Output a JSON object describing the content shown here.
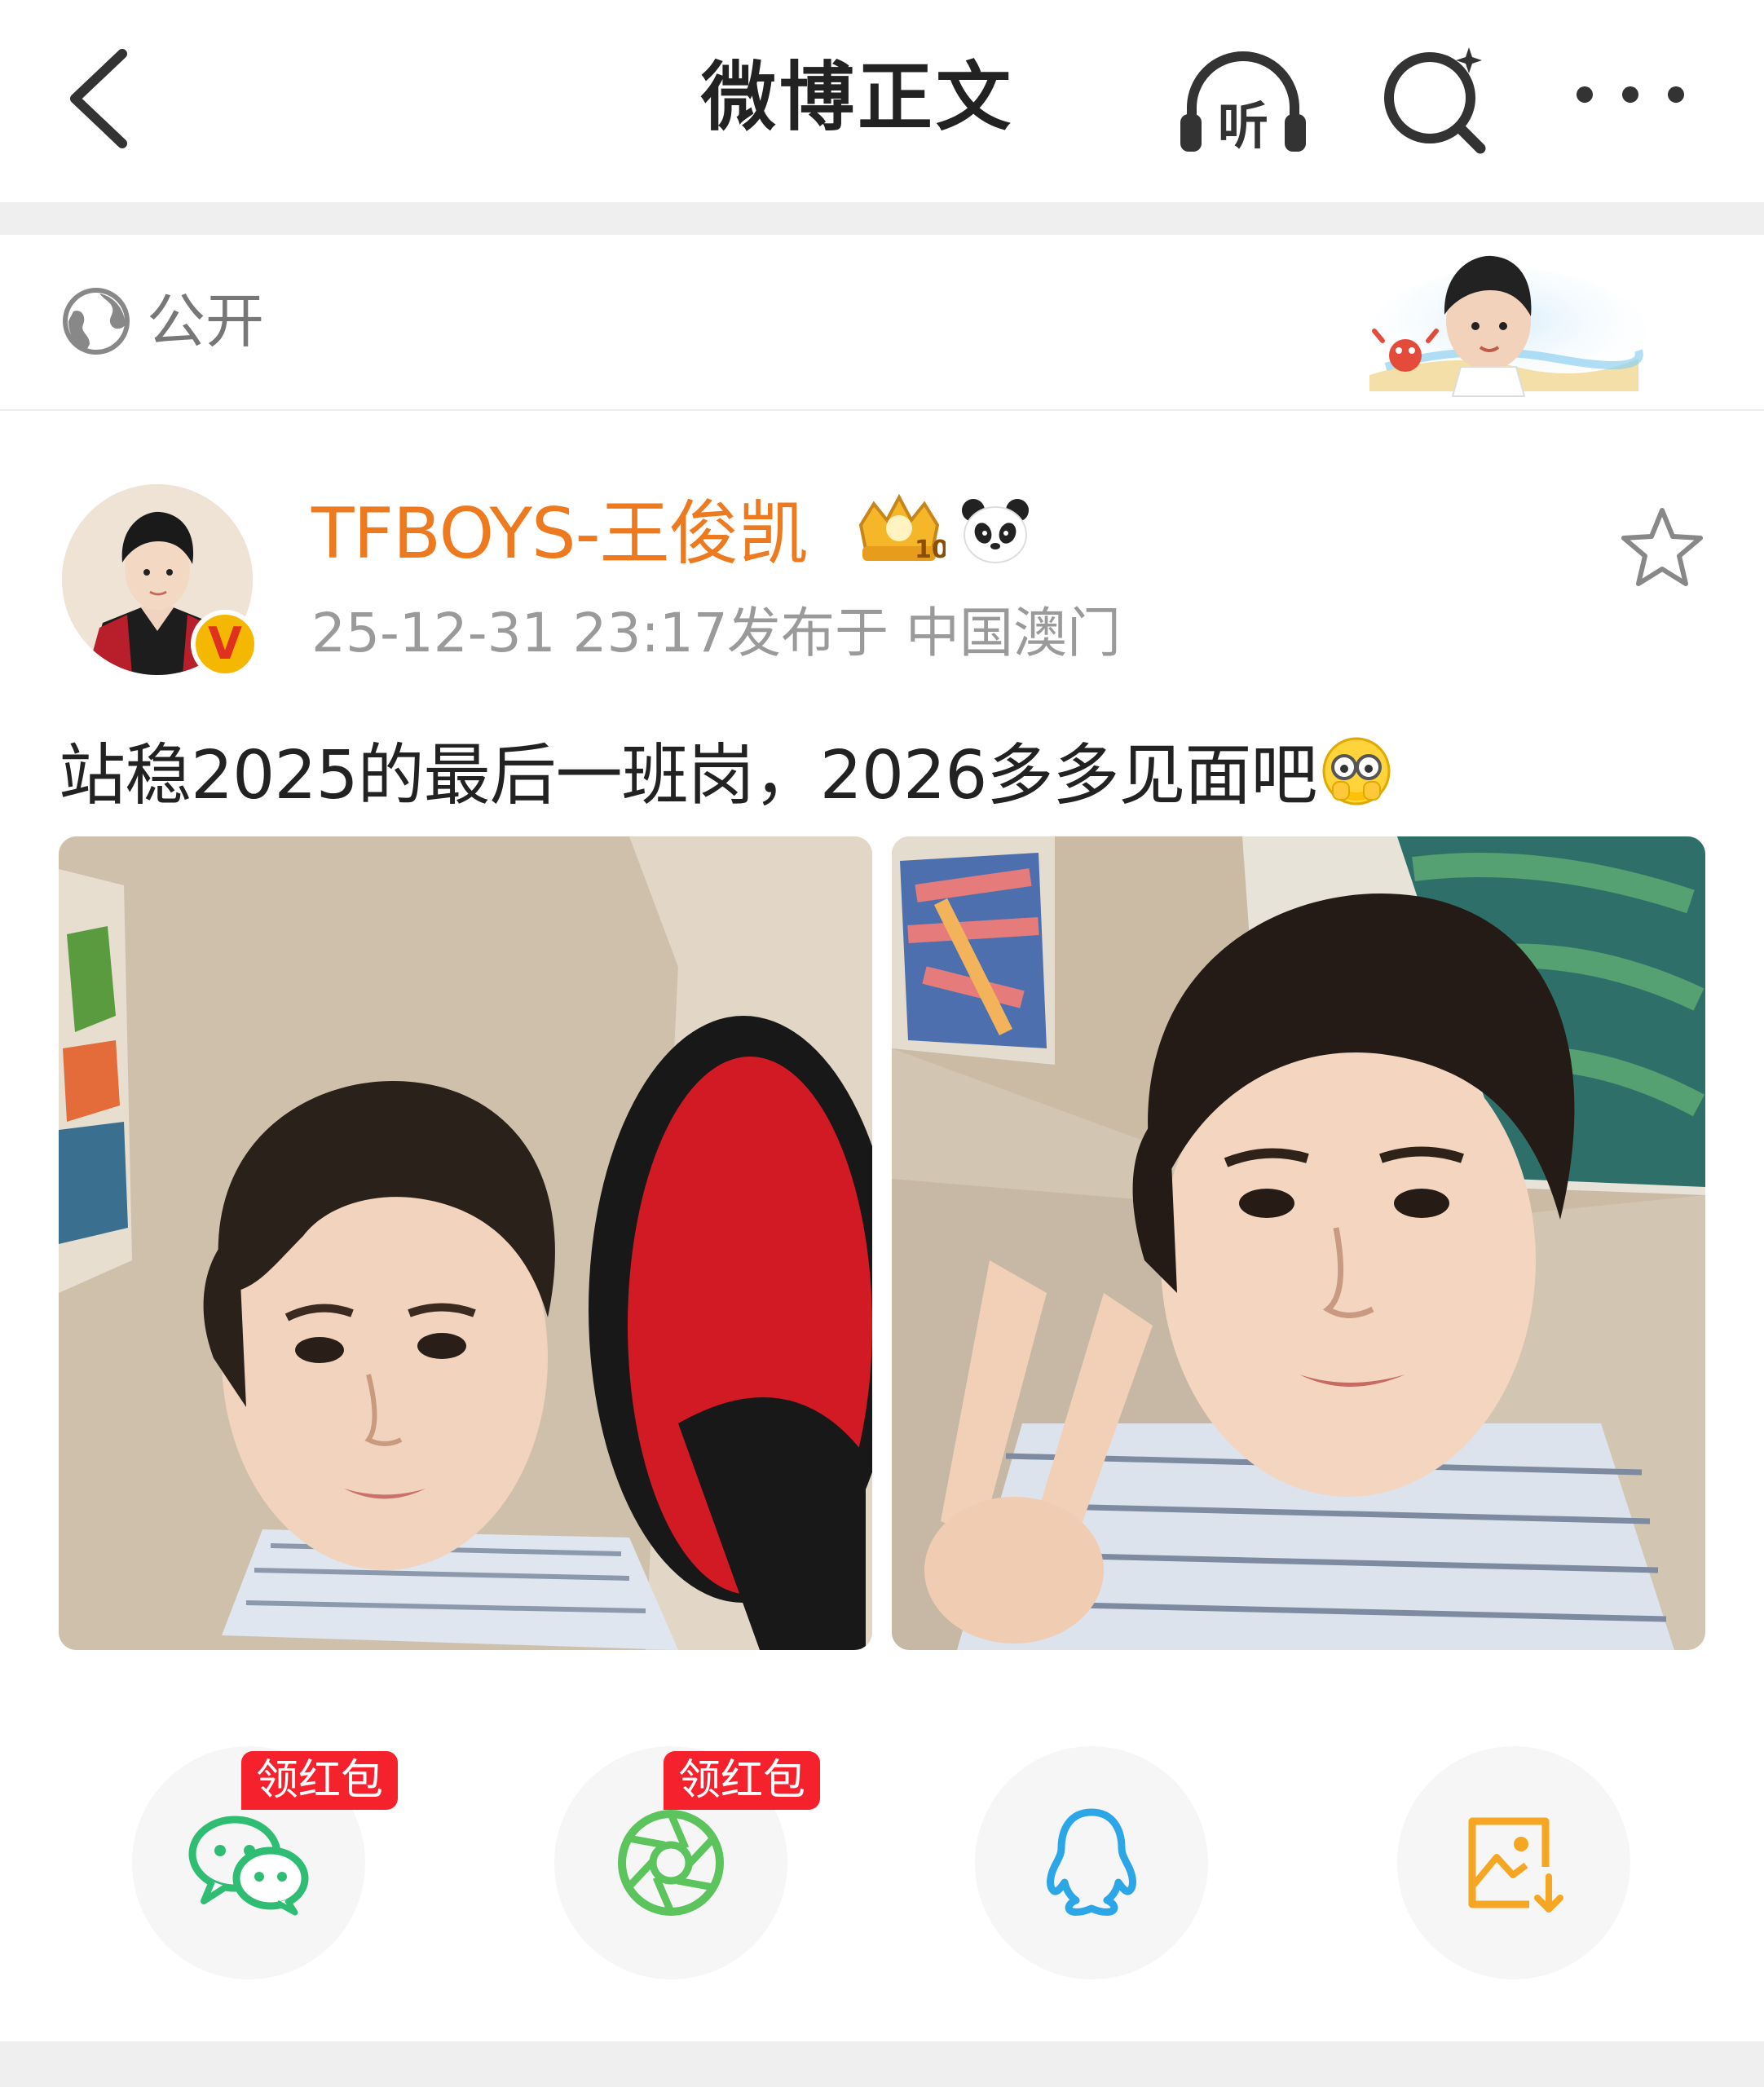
{
  "navbar": {
    "title": "微博正文",
    "listen_label": "听"
  },
  "visibility": {
    "label": "公开"
  },
  "post": {
    "author": "TFBOYS-王俊凯",
    "verified_mark": "V",
    "crown_badge_text": "10",
    "time": "25-12-31 23:17",
    "location": "发布于 中国澳门",
    "text": "站稳2025的最后一班岗，2026多多见面吧",
    "image_count": 2
  },
  "share": {
    "red_packet_label_1": "领红包",
    "red_packet_label_2": "领红包",
    "icons": [
      "wechat-icon",
      "moments-icon",
      "qq-icon",
      "save-image-icon"
    ]
  },
  "colors": {
    "author": "#ee7a20",
    "red_tag": "#f5212d",
    "wechat": "#2fbd74",
    "moments": "#5cc45c",
    "qq": "#2ba7e8",
    "save": "#f5a623"
  }
}
